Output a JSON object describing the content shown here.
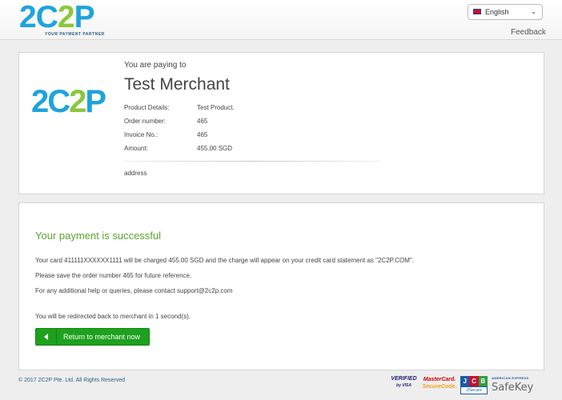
{
  "header": {
    "logo": {
      "part1": "2C",
      "part2": "2",
      "part3": "P",
      "tagline": "YOUR PAYMENT PARTNER"
    },
    "language": {
      "selected": "English",
      "flag_icon": "uk-flag-icon"
    },
    "feedback": "Feedback"
  },
  "merchant_panel": {
    "logo": {
      "part1": "2C",
      "part2": "2",
      "part3": "P"
    },
    "paying_to": "You are paying to",
    "merchant_name": "Test Merchant",
    "details": [
      {
        "label": "Product Details:",
        "value": "Test Product."
      },
      {
        "label": "Order number:",
        "value": "465"
      },
      {
        "label": "Invoice No.:",
        "value": "465"
      },
      {
        "label": "Amount:",
        "value": "455.00 SGD"
      }
    ],
    "address": "address"
  },
  "result_panel": {
    "title": "Your payment is successful",
    "message_card": "Your card 411111XXXXXX1111 will be charged 455.00 SGD and the charge will appear on your credit card statement as \"2C2P.COM\".",
    "message_save": "Please save the order number 465 for future reference.",
    "message_help": "For any additional help or queries, please contact support@2c2p.com",
    "message_redirect": "You will be redirected back to merchant in 1 second(s).",
    "return_button": "Return to merchant now"
  },
  "footer": {
    "copyright": "© 2017 2C2P Pte. Ltd. All Rights Reserved",
    "badges": {
      "visa_line1": "VERIFIED",
      "visa_line2": "by VISA",
      "mc_line1": "MasterCard.",
      "mc_line2": "SecureCode.",
      "jcb_letters": [
        "J",
        "C",
        "B"
      ],
      "jcb_sub": "J/Secure",
      "safekey_top": "AMERICAN EXPRESS",
      "safekey_main": "SafeKey"
    }
  },
  "colors": {
    "brand_blue": "#1fa3dc",
    "brand_green": "#8dc63f",
    "success_green": "#5aa530",
    "button_green": "#1ea11e"
  }
}
